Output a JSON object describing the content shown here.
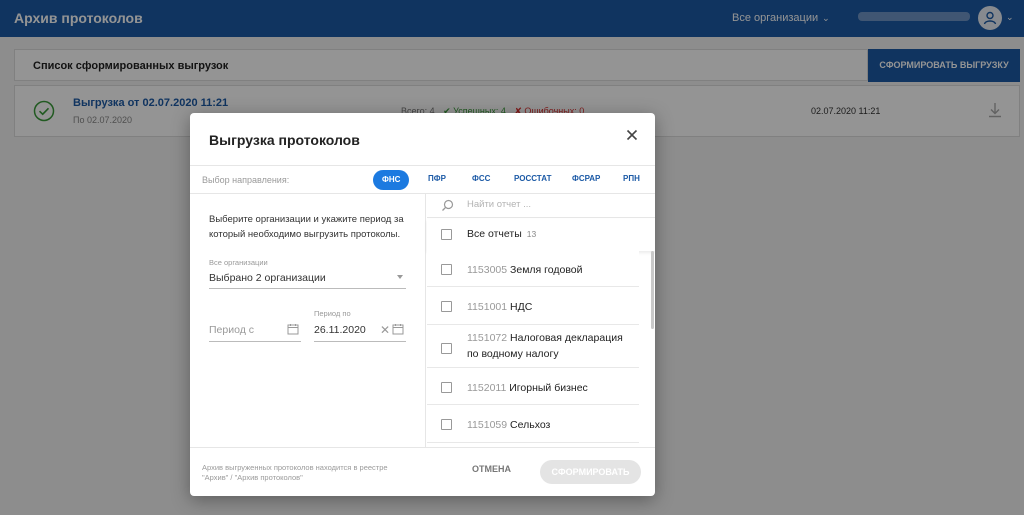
{
  "header": {
    "app_title": "Архив протоколов",
    "org_selector": "Все организации"
  },
  "background": {
    "list_title": "Список сформированных выгрузок",
    "generate_button": "СФОРМИРОВАТЬ ВЫГРУЗКУ",
    "row": {
      "title": "Выгрузка от 02.07.2020 11:21",
      "subtitle": "По 02.07.2020",
      "total": "Всего: 4",
      "success": "✔ Успешных: 4",
      "errors": "✘ Ошибочных: 0",
      "date": "02.07.2020 11:21"
    }
  },
  "modal": {
    "title": "Выгрузка протоколов",
    "direction_label": "Выбор направления:",
    "tabs": [
      {
        "label": "ФНС",
        "active": true
      },
      {
        "label": "ПФР",
        "active": false
      },
      {
        "label": "ФСС",
        "active": false
      },
      {
        "label": "РОССТАТ",
        "active": false
      },
      {
        "label": "ФСРАР",
        "active": false
      },
      {
        "label": "РПН",
        "active": false
      }
    ],
    "instruction": "Выберите организации и укажите период за который необходимо выгрузить протоколы.",
    "org_field_label": "Все организации",
    "org_field_value": "Выбрано 2 организации",
    "period_from_placeholder": "Период с",
    "period_to_label": "Период по",
    "period_to_value": "26.11.2020",
    "search_placeholder": "Найти отчет ...",
    "all_reports_label": "Все отчеты",
    "all_reports_count": "13",
    "reports": [
      {
        "code": "1153005",
        "name": "Земля годовой"
      },
      {
        "code": "1151001",
        "name": "НДС"
      },
      {
        "code": "1151072",
        "name": "Налоговая декларация",
        "name2": "по водному налогу"
      },
      {
        "code": "1152011",
        "name": "Игорный бизнес"
      },
      {
        "code": "1151059",
        "name": "Сельхоз"
      }
    ],
    "footer_note": "Архив выгруженных протоколов находится в реестре \"Архив\" / \"Архив протоколов\"",
    "cancel_label": "ОТМЕНА",
    "submit_label": "СФОРМИРОВАТЬ"
  },
  "colors": {
    "brand": "#1c5aa6",
    "active_tab": "#1c7ae0",
    "success": "#3a9b3a",
    "error": "#dd3333"
  }
}
